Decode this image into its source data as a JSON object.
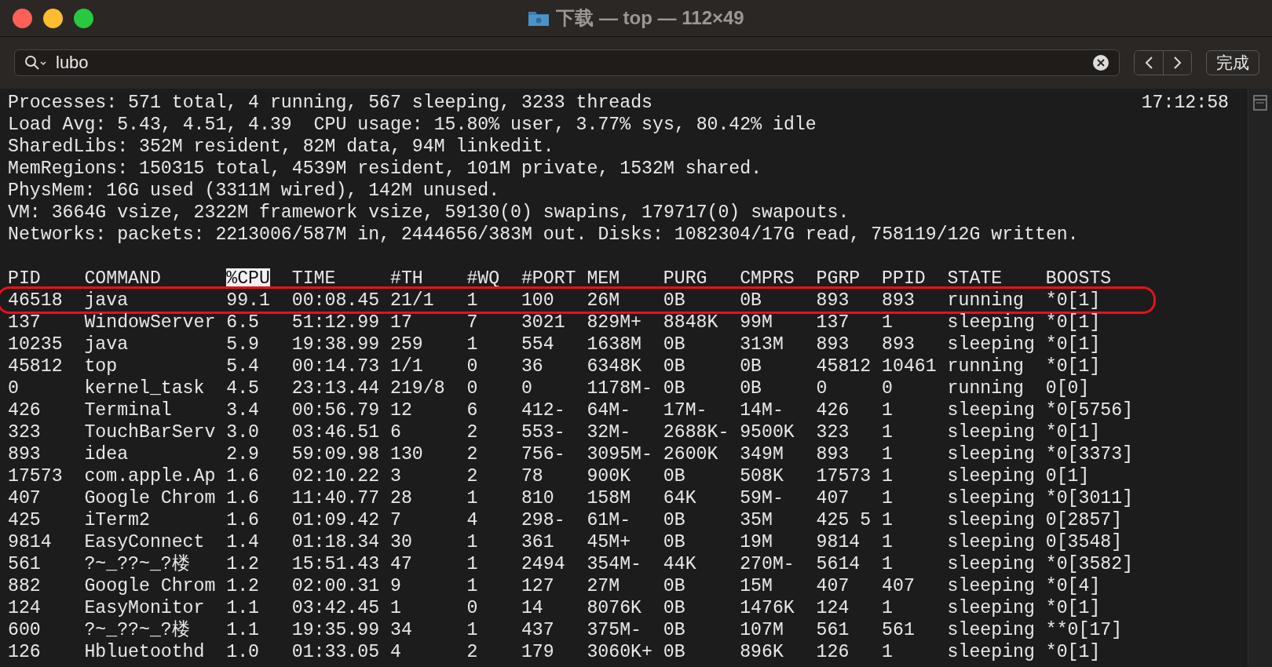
{
  "window": {
    "title": "下载 — top — 112×49"
  },
  "find_bar": {
    "value": "lubo",
    "done_button": "完成"
  },
  "terminal": {
    "clock": "17:12:58",
    "summary_lines": [
      "Processes: 571 total, 4 running, 567 sleeping, 3233 threads",
      "Load Avg: 5.43, 4.51, 4.39  CPU usage: 15.80% user, 3.77% sys, 80.42% idle",
      "SharedLibs: 352M resident, 82M data, 94M linkedit.",
      "MemRegions: 150315 total, 4539M resident, 101M private, 1532M shared.",
      "PhysMem: 16G used (3311M wired), 142M unused.",
      "VM: 3664G vsize, 2322M framework vsize, 59130(0) swapins, 179717(0) swapouts.",
      "Networks: packets: 2213006/587M in, 2444656/383M out. Disks: 1082304/17G read, 758119/12G written."
    ],
    "columns": [
      {
        "label": "PID",
        "selected": false
      },
      {
        "label": "COMMAND",
        "selected": false
      },
      {
        "label": "%CPU",
        "selected": true
      },
      {
        "label": "TIME",
        "selected": false
      },
      {
        "label": "#TH",
        "selected": false
      },
      {
        "label": "#WQ",
        "selected": false
      },
      {
        "label": "#PORT",
        "selected": false
      },
      {
        "label": "MEM",
        "selected": false
      },
      {
        "label": "PURG",
        "selected": false
      },
      {
        "label": "CMPRS",
        "selected": false
      },
      {
        "label": "PGRP",
        "selected": false
      },
      {
        "label": "PPID",
        "selected": false
      },
      {
        "label": "STATE",
        "selected": false
      },
      {
        "label": "BOOSTS",
        "selected": false
      }
    ],
    "rows": [
      {
        "circled": true,
        "cells": [
          "46518",
          "java",
          "99.1",
          "00:08.45",
          "21/1",
          "1",
          "100",
          "26M",
          "0B",
          "0B",
          "893",
          "893",
          "running",
          "*0[1]"
        ]
      },
      {
        "circled": false,
        "cells": [
          "137",
          "WindowServer",
          "6.5",
          "51:12.99",
          "17",
          "7",
          "3021",
          "829M+",
          "8848K",
          "99M",
          "137",
          "1",
          "sleeping",
          "*0[1]"
        ]
      },
      {
        "circled": false,
        "cells": [
          "10235",
          "java",
          "5.9",
          "19:38.99",
          "259",
          "1",
          "554",
          "1638M",
          "0B",
          "313M",
          "893",
          "893",
          "sleeping",
          "*0[1]"
        ]
      },
      {
        "circled": false,
        "cells": [
          "45812",
          "top",
          "5.4",
          "00:14.73",
          "1/1",
          "0",
          "36",
          "6348K",
          "0B",
          "0B",
          "45812",
          "10461",
          "running",
          "*0[1]"
        ]
      },
      {
        "circled": false,
        "cells": [
          "0",
          "kernel_task",
          "4.5",
          "23:13.44",
          "219/8",
          "0",
          "0",
          "1178M-",
          "0B",
          "0B",
          "0",
          "0",
          "running",
          "0[0]"
        ]
      },
      {
        "circled": false,
        "cells": [
          "426",
          "Terminal",
          "3.4",
          "00:56.79",
          "12",
          "6",
          "412-",
          "64M-",
          "17M-",
          "14M-",
          "426",
          "1",
          "sleeping",
          "*0[5756]"
        ]
      },
      {
        "circled": false,
        "cells": [
          "323",
          "TouchBarServ",
          "3.0",
          "03:46.51",
          "6",
          "2",
          "553-",
          "32M-",
          "2688K-",
          "9500K",
          "323",
          "1",
          "sleeping",
          "*0[1]"
        ]
      },
      {
        "circled": false,
        "cells": [
          "893",
          "idea",
          "2.9",
          "59:09.98",
          "130",
          "2",
          "756-",
          "3095M-",
          "2600K",
          "349M",
          "893",
          "1",
          "sleeping",
          "*0[3373]"
        ]
      },
      {
        "circled": false,
        "cells": [
          "17573",
          "com.apple.Ap",
          "1.6",
          "02:10.22",
          "3",
          "2",
          "78",
          "900K",
          "0B",
          "508K",
          "17573",
          "1",
          "sleeping",
          "0[1]"
        ]
      },
      {
        "circled": false,
        "cells": [
          "407",
          "Google Chrom",
          "1.6",
          "11:40.77",
          "28",
          "1",
          "810",
          "158M",
          "64K",
          "59M-",
          "407",
          "1",
          "sleeping",
          "*0[3011]"
        ]
      },
      {
        "circled": false,
        "cells": [
          "425",
          "iTerm2",
          "1.6",
          "01:09.42",
          "7",
          "4",
          "298-",
          "61M-",
          "0B",
          "35M",
          "425 5",
          "1",
          "sleeping",
          "0[2857]"
        ]
      },
      {
        "circled": false,
        "cells": [
          "9814",
          "EasyConnect",
          "1.4",
          "01:18.34",
          "30",
          "1",
          "361",
          "45M+",
          "0B",
          "19M",
          "9814",
          "1",
          "sleeping",
          "0[3548]"
        ]
      },
      {
        "circled": false,
        "cells": [
          "561",
          "?~_??~_?楼",
          "1.2",
          "15:51.43",
          "47",
          "1",
          "2494",
          "354M-",
          "44K",
          "270M-",
          "5614",
          "1",
          "sleeping",
          "*0[3582]"
        ]
      },
      {
        "circled": false,
        "cells": [
          "882",
          "Google Chrom",
          "1.2",
          "02:00.31",
          "9",
          "1",
          "127",
          "27M",
          "0B",
          "15M",
          "407",
          "407",
          "sleeping",
          "*0[4]"
        ]
      },
      {
        "circled": false,
        "cells": [
          "124",
          "EasyMonitor",
          "1.1",
          "03:42.45",
          "1",
          "0",
          "14",
          "8076K",
          "0B",
          "1476K",
          "124",
          "1",
          "sleeping",
          "*0[1]"
        ]
      },
      {
        "circled": false,
        "cells": [
          "600",
          "?~_??~_?楼",
          "1.1",
          "19:35.99",
          "34",
          "1",
          "437",
          "375M-",
          "0B",
          "107M",
          "561",
          "561",
          "sleeping",
          "**0[17]"
        ]
      },
      {
        "circled": false,
        "cells": [
          "126",
          "Hbluetoothd",
          "1.0",
          "01:33.05",
          "4",
          "2",
          "179",
          "3060K+",
          "0B",
          "896K",
          "126",
          "1",
          "sleeping",
          "*0[1]"
        ]
      }
    ]
  }
}
